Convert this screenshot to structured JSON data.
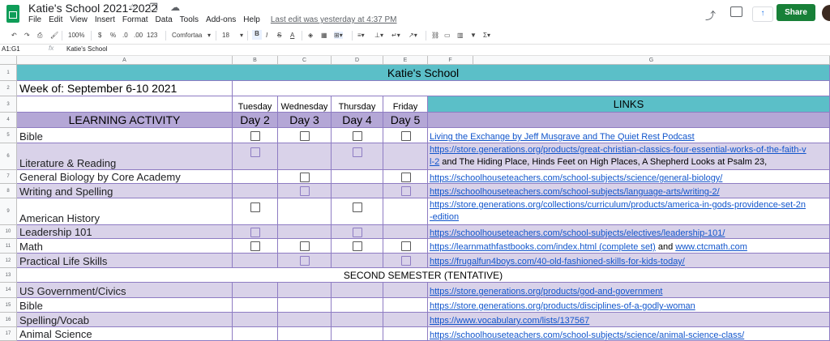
{
  "app": {
    "doc_title": "Katie's School 2021-2022",
    "menu": [
      "File",
      "Edit",
      "View",
      "Insert",
      "Format",
      "Data",
      "Tools",
      "Add-ons",
      "Help"
    ],
    "last_edit": "Last edit was yesterday at 4:37 PM",
    "share_label": "Share",
    "present_icon": "↑",
    "title_icons": "☆ ❐ ☁"
  },
  "toolbar": {
    "zoom": "100%",
    "currency": "$",
    "percent": "%",
    "dec_less": ".0",
    "dec_more": ".00",
    "format_123": "123",
    "font": "Comfortaa",
    "font_size": "18",
    "bold": "B",
    "italic": "I",
    "strike": "S",
    "textcolor": "A"
  },
  "formula": {
    "namebox": "A1:G1",
    "fx": "fx",
    "content": "Katie's School"
  },
  "columns": [
    "A",
    "B",
    "C",
    "D",
    "E",
    "F",
    "G"
  ],
  "rows": [
    "1",
    "2",
    "3",
    "4",
    "5",
    "6",
    "7",
    "8",
    "9",
    "10",
    "11",
    "12",
    "13",
    "14",
    "15",
    "16",
    "17"
  ],
  "sheet": {
    "title": "Katie's School",
    "week": "Week of: September 6-10 2021",
    "weekdays": [
      "Tuesday",
      "Wednesday",
      "Thursday",
      "Friday"
    ],
    "links_header": "LINKS",
    "activity_header": "LEARNING ACTIVITY",
    "days": [
      "Day 2",
      "Day 3",
      "Day 4",
      "Day 5"
    ],
    "activities": [
      {
        "name": "Bible",
        "link": "Living the Exchange by Jeff Musgrave and The Quiet Rest Podcast"
      },
      {
        "name": "Literature & Reading",
        "link": "https://store.generations.org/products/great-christian-classics-four-essential-works-of-the-faith-v",
        "link2": "l-2",
        "text2": " and The Hiding Place, Hinds Feet on High Places, A Shepherd Looks at Psalm 23,"
      },
      {
        "name": "General Biology by Core Academy",
        "link": "https://schoolhouseteachers.com/school-subjects/science/general-biology/"
      },
      {
        "name": "Writing and Spelling",
        "link": "https://schoolhouseteachers.com/school-subjects/language-arts/writing-2/"
      },
      {
        "name": "American History",
        "link": "https://store.generations.org/collections/curriculum/products/america-in-gods-providence-set-2n",
        "link2": "-edition"
      },
      {
        "name": "Leadership 101",
        "link": "https://schoolhouseteachers.com/school-subjects/electives/leadership-101/"
      },
      {
        "name": "Math",
        "link": "https://learnmathfastbooks.com/index.html (complete set)",
        "text_mid": " and ",
        "link_b": "www.ctcmath.com"
      },
      {
        "name": "Practical Life Skills",
        "link": "https://frugalfun4boys.com/40-old-fashioned-skills-for-kids-today/"
      }
    ],
    "second_semester": "SECOND SEMESTER (TENTATIVE)",
    "second_activities": [
      {
        "name": "US Government/Civics",
        "link": "https://store.generations.org/products/god-and-government"
      },
      {
        "name": "Bible",
        "link": "https://store.generations.org/products/disciplines-of-a-godly-woman"
      },
      {
        "name": "Spelling/Vocab",
        "link": " https://www.vocabulary.com/lists/137567"
      },
      {
        "name": "Animal Science",
        "link": "https://schoolhouseteachers.com/school-subjects/science/animal-science-class/"
      }
    ]
  }
}
